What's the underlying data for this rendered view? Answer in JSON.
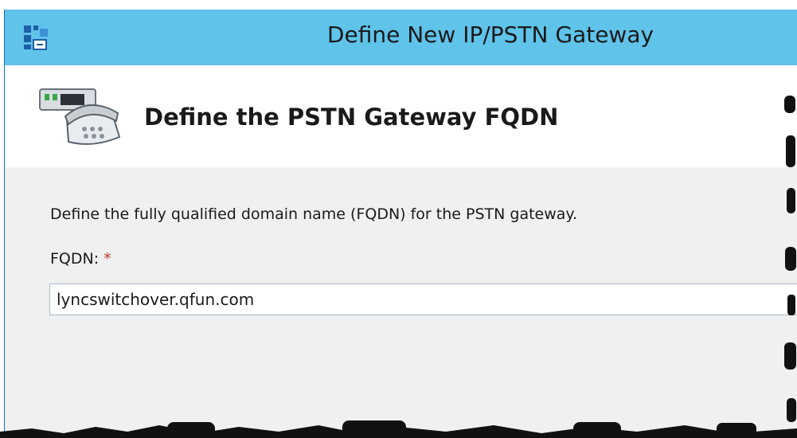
{
  "window": {
    "title": "Define New IP/PSTN Gateway",
    "app_icon": "topology-builder-icon"
  },
  "header": {
    "icon": "pstn-gateway-phone-icon",
    "title": "Define the PSTN Gateway FQDN"
  },
  "form": {
    "description": "Define the fully qualified domain name (FQDN) for the PSTN gateway.",
    "fqdn_label": "FQDN:",
    "required_marker": "*",
    "fqdn_value": "lyncswitchover.qfun.com"
  },
  "colors": {
    "titlebar": "#5fc3ea",
    "panel": "#f0f0f0",
    "required": "#c0392b"
  }
}
